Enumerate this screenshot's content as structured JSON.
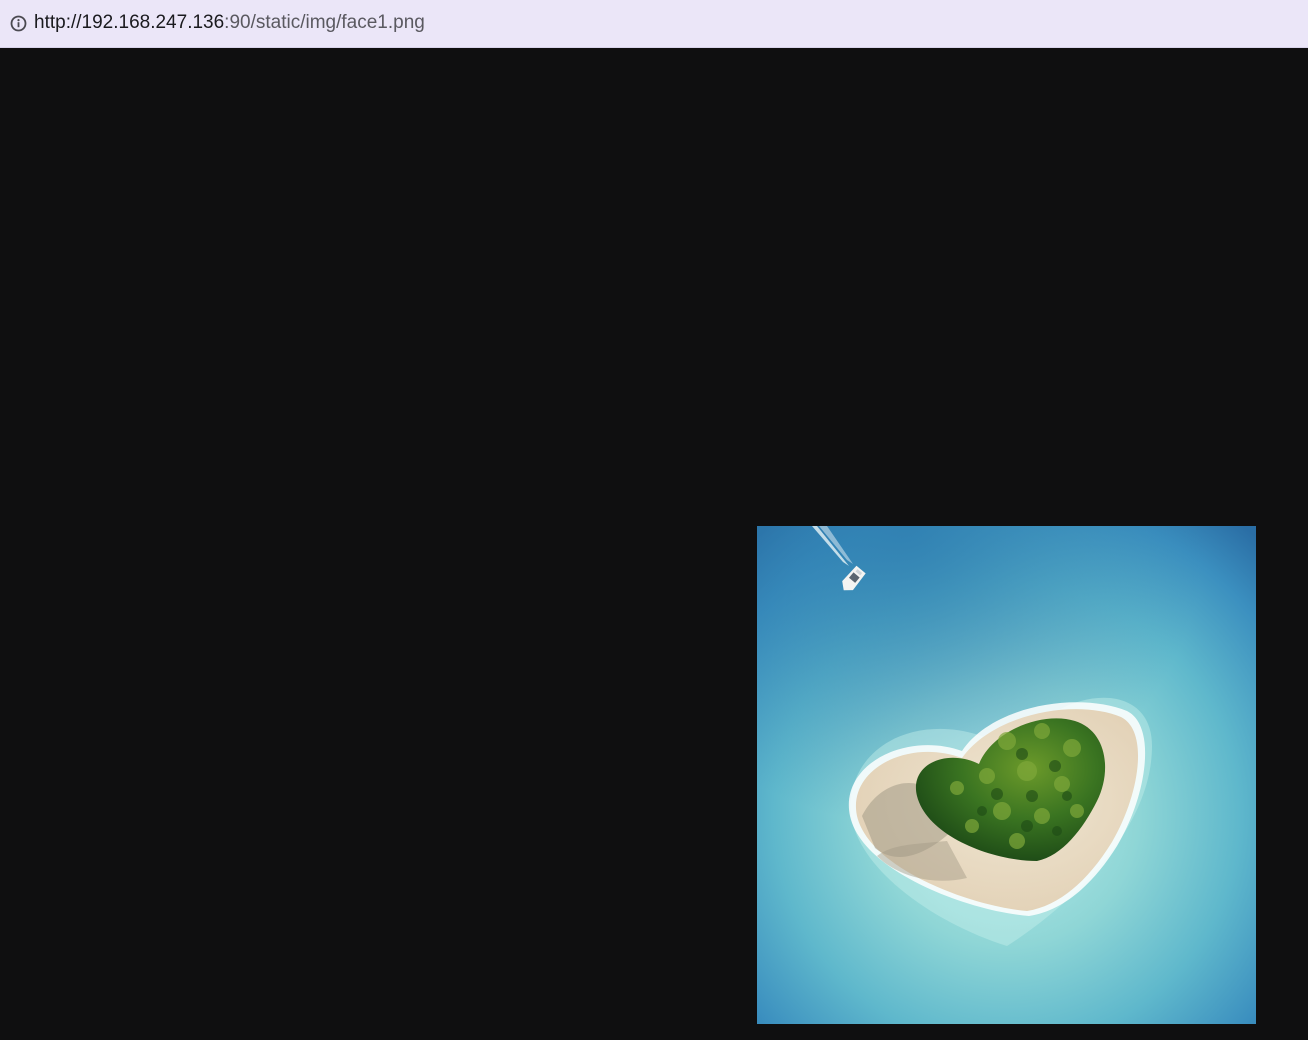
{
  "address_bar": {
    "url_host": "http://192.168.247.136",
    "url_rest": ":90/static/img/face1.png",
    "info_icon": "info-circle-icon"
  },
  "image": {
    "subject": "aerial view of heart-shaped tropical island with boat",
    "colors": {
      "deep_water": "#2f7fb1",
      "lagoon": "#8fd6d6",
      "sand": "#e9dcc6",
      "palms": "#2f6a1e",
      "page_background": "#0f0f10"
    }
  }
}
